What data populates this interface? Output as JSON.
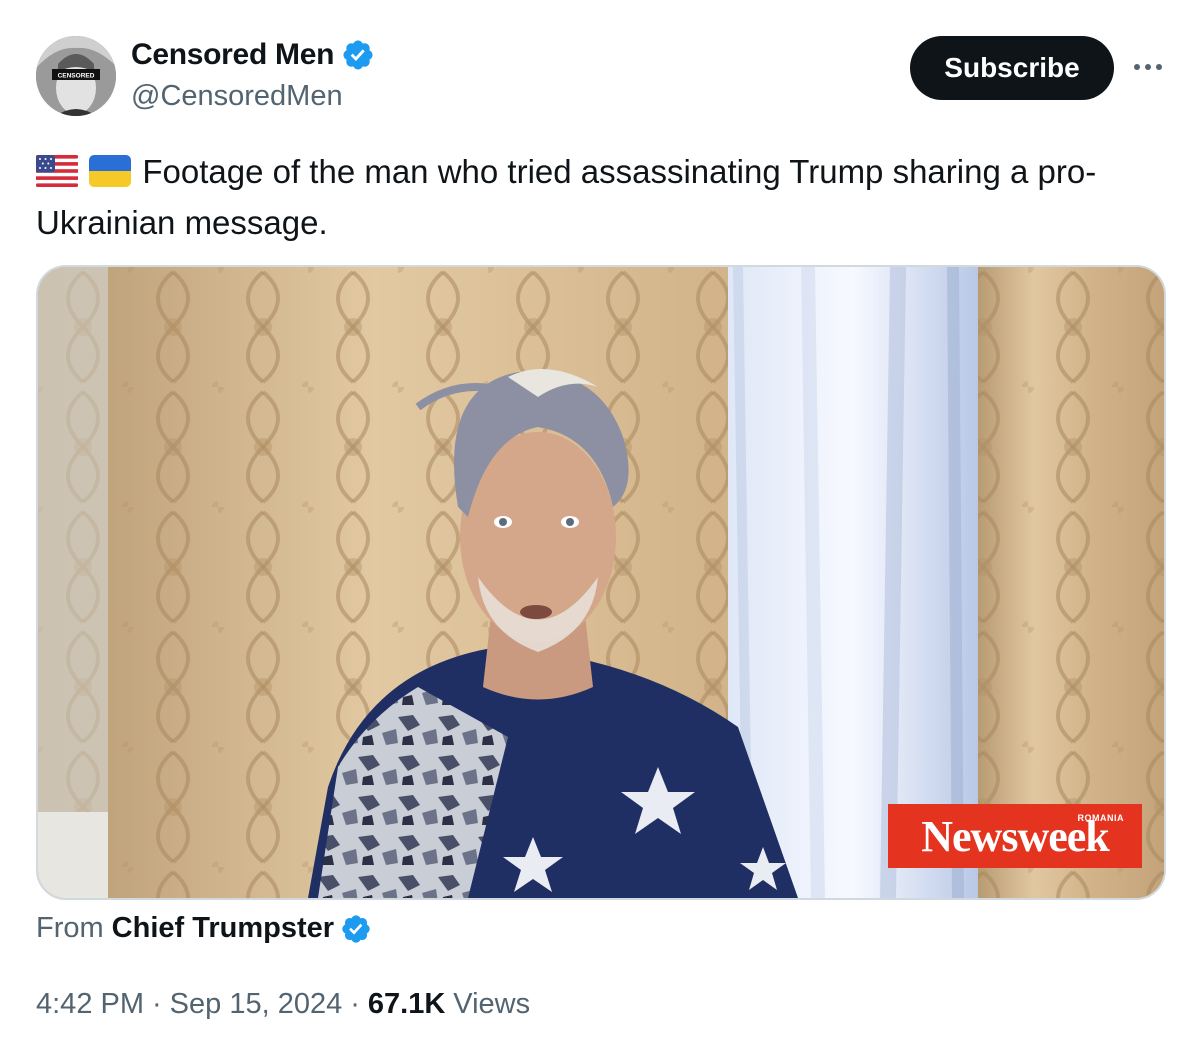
{
  "author": {
    "display_name": "Censored Men",
    "handle": "@CensoredMen",
    "avatar_label": "CENSORED",
    "verified": true
  },
  "actions": {
    "subscribe_label": "Subscribe",
    "more_icon": "more-horizontal-icon"
  },
  "tweet": {
    "flags": [
      "🇺🇸",
      "🇺🇦"
    ],
    "text_line1": "Footage of the man who tried assassinating Trump sharing a pro-",
    "text_line2": "Ukrainian message."
  },
  "media": {
    "watermark_brand": "Newsweek",
    "watermark_region": "ROMANIA"
  },
  "source": {
    "from_label": "From",
    "from_name": "Chief Trumpster",
    "verified": true
  },
  "meta": {
    "time": "4:42 PM",
    "separator": "·",
    "date": "Sep 15, 2024",
    "views_count": "67.1K",
    "views_label": "Views"
  },
  "colors": {
    "verified_blue": "#1d9bf0",
    "text_primary": "#0f1419",
    "text_secondary": "#536471",
    "border": "#cfd9de",
    "watermark_red": "#e4331f"
  }
}
